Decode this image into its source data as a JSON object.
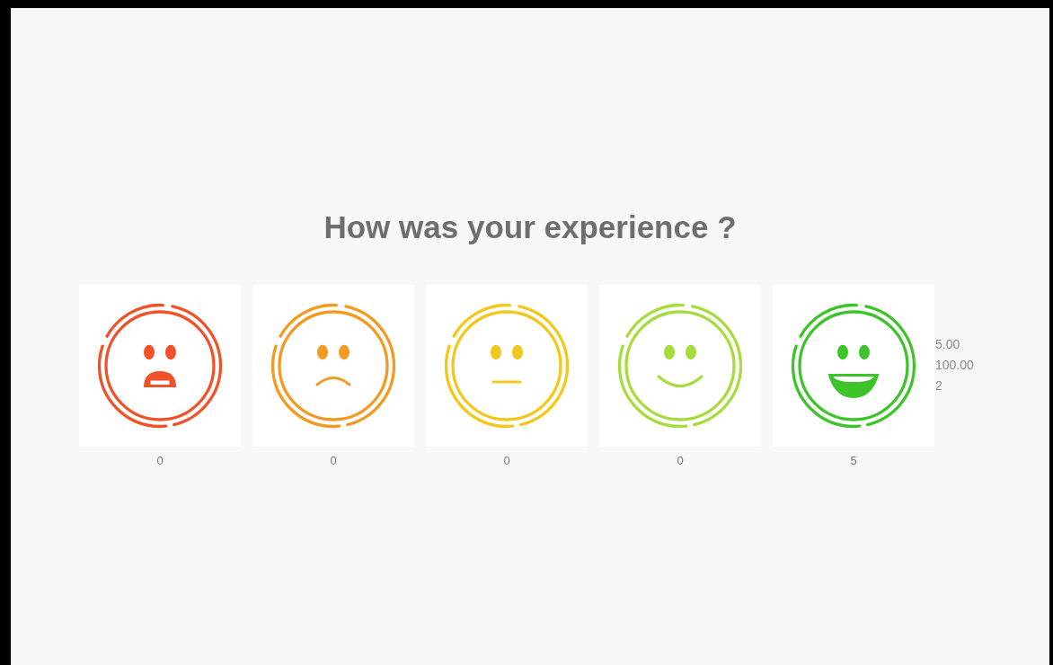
{
  "title": "How was your experience ?",
  "ratings": [
    {
      "kind": "shocked",
      "color": "#f0522a",
      "count": "0"
    },
    {
      "kind": "sad",
      "color": "#f39a22",
      "count": "0"
    },
    {
      "kind": "neutral",
      "color": "#f2c81e",
      "count": "0"
    },
    {
      "kind": "smile",
      "color": "#a6dc3c",
      "count": "0"
    },
    {
      "kind": "grin",
      "color": "#3cc42a",
      "count": "5"
    }
  ],
  "stats": [
    "5.00",
    "100.00",
    "2"
  ]
}
